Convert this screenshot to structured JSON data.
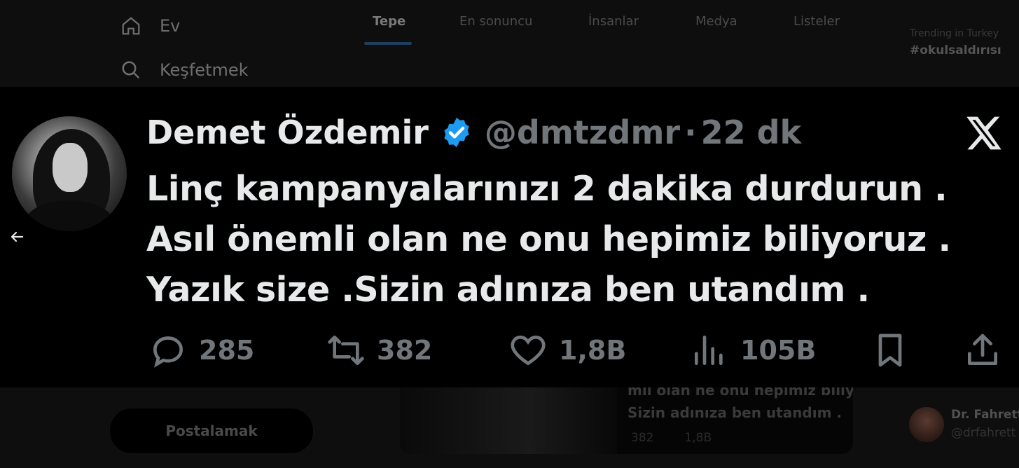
{
  "nav": {
    "home_label": "Ev",
    "explore_label": "Keşfetmek",
    "post_button": "Postalamak"
  },
  "search_tabs": [
    "Tepe",
    "En sonuncu",
    "İnsanlar",
    "Medya",
    "Listeler"
  ],
  "sidebar": {
    "trend_context": "Trending in Turkey",
    "trend_tag": "#okulsaldırısı"
  },
  "background_card": {
    "line1": "mli olan ne onu hepimiz biliyor",
    "line2": "Sizin adınıza ben utandım .",
    "retweets": "382",
    "likes": "1,8B"
  },
  "suggestion": {
    "name": "Dr. Fahrett",
    "handle": "@drfahrett"
  },
  "tweet": {
    "display_name": "Demet Özdemir",
    "handle": "@dmtzdmr",
    "separator": "·",
    "time": "22 dk",
    "text": "Linç kampanyalarınızı 2 dakika durdurun . Asıl önemli olan ne onu hepimiz biliyoruz . Yazık size .Sizin adınıza ben utandım .",
    "replies": "285",
    "retweets": "382",
    "likes": "1,8B",
    "views": "105B",
    "verified_color": "#1d9bf0"
  }
}
